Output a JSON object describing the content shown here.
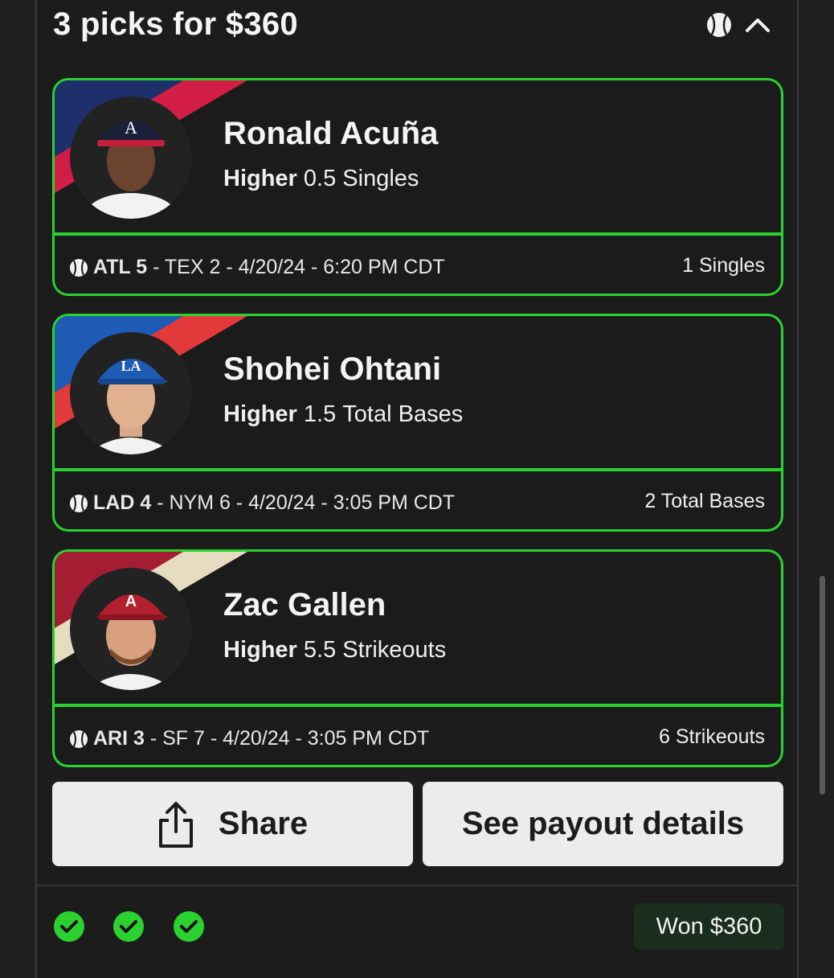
{
  "header": {
    "title": "3 picks for $360",
    "sport_icon": "baseball-icon",
    "collapse_icon": "chevron-up-icon"
  },
  "picks": [
    {
      "player": "Ronald Acuña",
      "direction": "Higher",
      "line": "0.5",
      "stat": "Singles",
      "team": "ATL 5",
      "game": "- TEX 2 - 4/20/24 - 6:20 PM CDT",
      "result": "1 Singles",
      "colors": {
        "a": "#1f2f6b",
        "b": "#d21e45",
        "cap": "#1a1f3a",
        "jersey": "#f2f2f2"
      }
    },
    {
      "player": "Shohei Ohtani",
      "direction": "Higher",
      "line": "1.5",
      "stat": "Total Bases",
      "team": "LAD 4",
      "game": "- NYM 6 - 4/20/24 - 3:05 PM CDT",
      "result": "2 Total Bases",
      "colors": {
        "a": "#1d5bb5",
        "b": "#e23a3a",
        "cap": "#1d5bb5",
        "jersey": "#f2f2f2"
      }
    },
    {
      "player": "Zac Gallen",
      "direction": "Higher",
      "line": "5.5",
      "stat": "Strikeouts",
      "team": "ARI 3",
      "game": "- SF 7 - 4/20/24 - 3:05 PM CDT",
      "result": "6 Strikeouts",
      "colors": {
        "a": "#a51d33",
        "b": "#e6dcc0",
        "cap": "#b31f2e",
        "jersey": "#f2f2f2"
      }
    }
  ],
  "actions": {
    "share": "Share",
    "payout": "See payout details"
  },
  "footer": {
    "status": "Won $360",
    "checks": 3
  },
  "accent": "#2ad12f"
}
